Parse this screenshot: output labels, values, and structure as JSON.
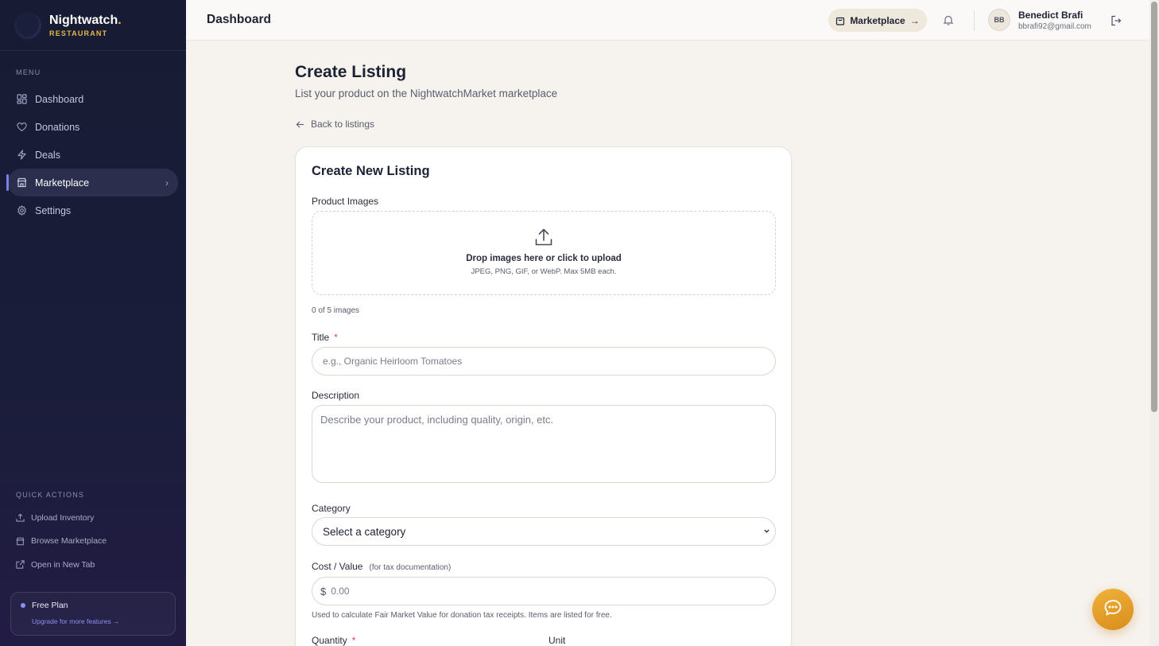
{
  "brand": {
    "name": "Nightwatch",
    "dot": ".",
    "subtitle": "RESTAURANT"
  },
  "sidebar": {
    "menu_label": "MENU",
    "items": [
      {
        "label": "Dashboard",
        "icon": "grid-icon",
        "active": false
      },
      {
        "label": "Donations",
        "icon": "heart-icon",
        "active": false
      },
      {
        "label": "Deals",
        "icon": "lightning-icon",
        "active": false
      },
      {
        "label": "Marketplace",
        "icon": "store-icon",
        "active": true
      },
      {
        "label": "Settings",
        "icon": "gear-icon",
        "active": false
      }
    ],
    "quick_actions_label": "QUICK ACTIONS",
    "quick_actions": [
      {
        "label": "Upload Inventory",
        "icon": "upload-icon"
      },
      {
        "label": "Browse Marketplace",
        "icon": "store-icon"
      },
      {
        "label": "Open in New Tab",
        "icon": "external-link-icon"
      }
    ],
    "plan": {
      "title": "Free Plan",
      "link": "Upgrade for more features →"
    }
  },
  "header": {
    "title": "Dashboard",
    "marketplace_button": "Marketplace",
    "user": {
      "initials": "BB",
      "name": "Benedict Brafi",
      "email": "bbrafi92@gmail.com"
    }
  },
  "page": {
    "title": "Create Listing",
    "subtitle": "List your product on the NightwatchMarket marketplace",
    "back_link": "Back to listings"
  },
  "form": {
    "card_title": "Create New Listing",
    "images": {
      "label": "Product Images",
      "drop_text": "Drop images here or click to upload",
      "formats": "JPEG, PNG, GIF, or WebP. Max 5MB each.",
      "count": "0 of 5 images"
    },
    "title": {
      "label": "Title",
      "required_mark": "*",
      "placeholder": "e.g., Organic Heirloom Tomatoes"
    },
    "description": {
      "label": "Description",
      "placeholder": "Describe your product, including quality, origin, etc."
    },
    "category": {
      "label": "Category",
      "selected": "Select a category"
    },
    "cost": {
      "label": "Cost / Value",
      "note": "(for tax documentation)",
      "currency": "$",
      "placeholder": "0.00",
      "hint": "Used to calculate Fair Market Value for donation tax receipts. Items are listed for free."
    },
    "quantity": {
      "label": "Quantity",
      "required_mark": "*"
    },
    "unit": {
      "label": "Unit"
    }
  },
  "colors": {
    "sidebar_bg": "#171b33",
    "accent": "#7b7fe8",
    "brand_gold": "#e6b648",
    "chat_button": "#e49f2a",
    "required": "#e0414d"
  }
}
